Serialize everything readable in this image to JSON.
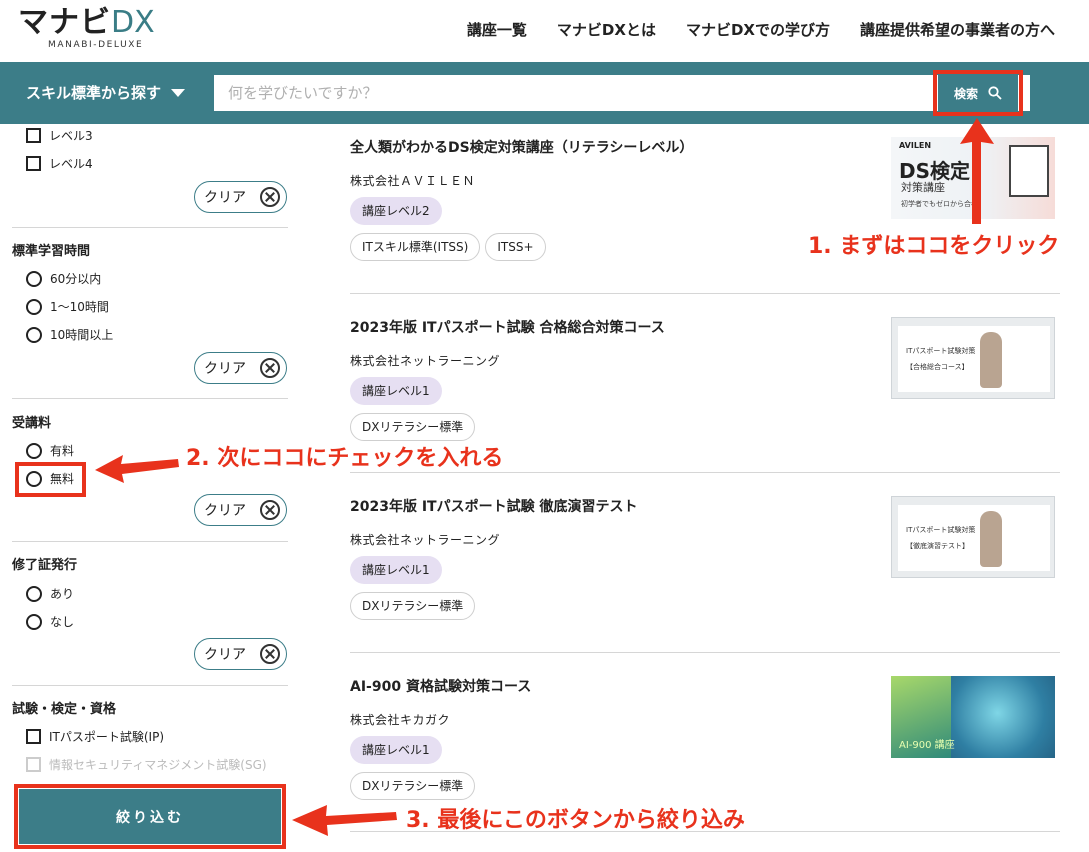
{
  "header": {
    "logo_text": "マナビ",
    "logo_dx": "DX",
    "logo_sub": "MANABI-DELUXE",
    "nav": [
      "講座一覧",
      "マナビDXとは",
      "マナビDXでの学び方",
      "講座提供希望の事業者の方へ"
    ]
  },
  "search": {
    "skill_dropdown": "スキル標準から探す",
    "placeholder": "何を学びたいですか？",
    "button": "検索"
  },
  "sidebar": {
    "level_items": [
      "レベル3",
      "レベル4"
    ],
    "clear_label": "クリア",
    "study_time": {
      "title": "標準学習時間",
      "options": [
        "60分以内",
        "1〜10時間",
        "10時間以上"
      ]
    },
    "fee": {
      "title": "受講料",
      "options": [
        "有料",
        "無料"
      ]
    },
    "certificate": {
      "title": "修了証発行",
      "options": [
        "あり",
        "なし"
      ]
    },
    "exam": {
      "title": "試験・検定・資格",
      "options": [
        "ITパスポート試験(IP)",
        "情報セキュリティマネジメント試験(SG)"
      ]
    },
    "apply_button": "絞り込む"
  },
  "courses": [
    {
      "title": "全人類がわかるDS検定対策講座（リテラシーレベル）",
      "company": "株式会社ＡＶＩＬＥＮ",
      "level": "講座レベル2",
      "standards": [
        "ITスキル標準(ITSS)",
        "ITSS+"
      ],
      "thumb_brand": "AVILEN",
      "thumb_title": "DS検定",
      "thumb_sub": "対策講座",
      "thumb_note": "初学者でもゼロから合格"
    },
    {
      "title": "2023年版 ITパスポート試験 合格総合対策コース",
      "company": "株式会社ネットラーニング",
      "level": "講座レベル1",
      "standards": [
        "DXリテラシー標準"
      ],
      "thumb_title": "ITパスポート試験対策",
      "thumb_sub": "【合格総合コース】"
    },
    {
      "title": "2023年版 ITパスポート試験 徹底演習テスト",
      "company": "株式会社ネットラーニング",
      "level": "講座レベル1",
      "standards": [
        "DXリテラシー標準"
      ],
      "thumb_title": "ITパスポート試験対策",
      "thumb_sub": "【徹底演習テスト】"
    },
    {
      "title": "AI-900 資格試験対策コース",
      "company": "株式会社キカガク",
      "level": "講座レベル1",
      "standards": [
        "DXリテラシー標準"
      ],
      "thumb_title": "AI-900 講座"
    }
  ],
  "annotations": {
    "step1": "1. まずはココをクリック",
    "step2": "2.  次にココにチェックを入れる",
    "step3": "3.  最後にこのボタンから絞り込み"
  },
  "colors": {
    "brand_teal": "#3c7d88",
    "annotation_red": "#e8321c",
    "level_tag_bg": "#e6dff2"
  }
}
